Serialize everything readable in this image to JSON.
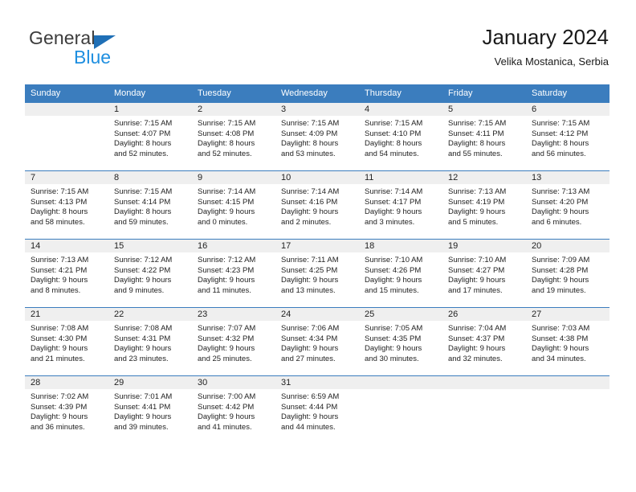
{
  "brand": {
    "name_top": "General",
    "name_bottom": "Blue",
    "triangle_color": "#1f6fb6",
    "blue_color": "#1f8fe0"
  },
  "header": {
    "title": "January 2024",
    "subtitle": "Velika Mostanica, Serbia"
  },
  "theme": {
    "header_blue": "#3b7dbe",
    "daynum_band": "#efefef",
    "text": "#222222"
  },
  "calendar": {
    "weekday_headers": [
      "Sunday",
      "Monday",
      "Tuesday",
      "Wednesday",
      "Thursday",
      "Friday",
      "Saturday"
    ],
    "weeks": [
      [
        {
          "day": "",
          "l1": "",
          "l2": "",
          "l3": "",
          "l4": ""
        },
        {
          "day": "1",
          "l1": "Sunrise: 7:15 AM",
          "l2": "Sunset: 4:07 PM",
          "l3": "Daylight: 8 hours",
          "l4": "and 52 minutes."
        },
        {
          "day": "2",
          "l1": "Sunrise: 7:15 AM",
          "l2": "Sunset: 4:08 PM",
          "l3": "Daylight: 8 hours",
          "l4": "and 52 minutes."
        },
        {
          "day": "3",
          "l1": "Sunrise: 7:15 AM",
          "l2": "Sunset: 4:09 PM",
          "l3": "Daylight: 8 hours",
          "l4": "and 53 minutes."
        },
        {
          "day": "4",
          "l1": "Sunrise: 7:15 AM",
          "l2": "Sunset: 4:10 PM",
          "l3": "Daylight: 8 hours",
          "l4": "and 54 minutes."
        },
        {
          "day": "5",
          "l1": "Sunrise: 7:15 AM",
          "l2": "Sunset: 4:11 PM",
          "l3": "Daylight: 8 hours",
          "l4": "and 55 minutes."
        },
        {
          "day": "6",
          "l1": "Sunrise: 7:15 AM",
          "l2": "Sunset: 4:12 PM",
          "l3": "Daylight: 8 hours",
          "l4": "and 56 minutes."
        }
      ],
      [
        {
          "day": "7",
          "l1": "Sunrise: 7:15 AM",
          "l2": "Sunset: 4:13 PM",
          "l3": "Daylight: 8 hours",
          "l4": "and 58 minutes."
        },
        {
          "day": "8",
          "l1": "Sunrise: 7:15 AM",
          "l2": "Sunset: 4:14 PM",
          "l3": "Daylight: 8 hours",
          "l4": "and 59 minutes."
        },
        {
          "day": "9",
          "l1": "Sunrise: 7:14 AM",
          "l2": "Sunset: 4:15 PM",
          "l3": "Daylight: 9 hours",
          "l4": "and 0 minutes."
        },
        {
          "day": "10",
          "l1": "Sunrise: 7:14 AM",
          "l2": "Sunset: 4:16 PM",
          "l3": "Daylight: 9 hours",
          "l4": "and 2 minutes."
        },
        {
          "day": "11",
          "l1": "Sunrise: 7:14 AM",
          "l2": "Sunset: 4:17 PM",
          "l3": "Daylight: 9 hours",
          "l4": "and 3 minutes."
        },
        {
          "day": "12",
          "l1": "Sunrise: 7:13 AM",
          "l2": "Sunset: 4:19 PM",
          "l3": "Daylight: 9 hours",
          "l4": "and 5 minutes."
        },
        {
          "day": "13",
          "l1": "Sunrise: 7:13 AM",
          "l2": "Sunset: 4:20 PM",
          "l3": "Daylight: 9 hours",
          "l4": "and 6 minutes."
        }
      ],
      [
        {
          "day": "14",
          "l1": "Sunrise: 7:13 AM",
          "l2": "Sunset: 4:21 PM",
          "l3": "Daylight: 9 hours",
          "l4": "and 8 minutes."
        },
        {
          "day": "15",
          "l1": "Sunrise: 7:12 AM",
          "l2": "Sunset: 4:22 PM",
          "l3": "Daylight: 9 hours",
          "l4": "and 9 minutes."
        },
        {
          "day": "16",
          "l1": "Sunrise: 7:12 AM",
          "l2": "Sunset: 4:23 PM",
          "l3": "Daylight: 9 hours",
          "l4": "and 11 minutes."
        },
        {
          "day": "17",
          "l1": "Sunrise: 7:11 AM",
          "l2": "Sunset: 4:25 PM",
          "l3": "Daylight: 9 hours",
          "l4": "and 13 minutes."
        },
        {
          "day": "18",
          "l1": "Sunrise: 7:10 AM",
          "l2": "Sunset: 4:26 PM",
          "l3": "Daylight: 9 hours",
          "l4": "and 15 minutes."
        },
        {
          "day": "19",
          "l1": "Sunrise: 7:10 AM",
          "l2": "Sunset: 4:27 PM",
          "l3": "Daylight: 9 hours",
          "l4": "and 17 minutes."
        },
        {
          "day": "20",
          "l1": "Sunrise: 7:09 AM",
          "l2": "Sunset: 4:28 PM",
          "l3": "Daylight: 9 hours",
          "l4": "and 19 minutes."
        }
      ],
      [
        {
          "day": "21",
          "l1": "Sunrise: 7:08 AM",
          "l2": "Sunset: 4:30 PM",
          "l3": "Daylight: 9 hours",
          "l4": "and 21 minutes."
        },
        {
          "day": "22",
          "l1": "Sunrise: 7:08 AM",
          "l2": "Sunset: 4:31 PM",
          "l3": "Daylight: 9 hours",
          "l4": "and 23 minutes."
        },
        {
          "day": "23",
          "l1": "Sunrise: 7:07 AM",
          "l2": "Sunset: 4:32 PM",
          "l3": "Daylight: 9 hours",
          "l4": "and 25 minutes."
        },
        {
          "day": "24",
          "l1": "Sunrise: 7:06 AM",
          "l2": "Sunset: 4:34 PM",
          "l3": "Daylight: 9 hours",
          "l4": "and 27 minutes."
        },
        {
          "day": "25",
          "l1": "Sunrise: 7:05 AM",
          "l2": "Sunset: 4:35 PM",
          "l3": "Daylight: 9 hours",
          "l4": "and 30 minutes."
        },
        {
          "day": "26",
          "l1": "Sunrise: 7:04 AM",
          "l2": "Sunset: 4:37 PM",
          "l3": "Daylight: 9 hours",
          "l4": "and 32 minutes."
        },
        {
          "day": "27",
          "l1": "Sunrise: 7:03 AM",
          "l2": "Sunset: 4:38 PM",
          "l3": "Daylight: 9 hours",
          "l4": "and 34 minutes."
        }
      ],
      [
        {
          "day": "28",
          "l1": "Sunrise: 7:02 AM",
          "l2": "Sunset: 4:39 PM",
          "l3": "Daylight: 9 hours",
          "l4": "and 36 minutes."
        },
        {
          "day": "29",
          "l1": "Sunrise: 7:01 AM",
          "l2": "Sunset: 4:41 PM",
          "l3": "Daylight: 9 hours",
          "l4": "and 39 minutes."
        },
        {
          "day": "30",
          "l1": "Sunrise: 7:00 AM",
          "l2": "Sunset: 4:42 PM",
          "l3": "Daylight: 9 hours",
          "l4": "and 41 minutes."
        },
        {
          "day": "31",
          "l1": "Sunrise: 6:59 AM",
          "l2": "Sunset: 4:44 PM",
          "l3": "Daylight: 9 hours",
          "l4": "and 44 minutes."
        },
        {
          "day": "",
          "l1": "",
          "l2": "",
          "l3": "",
          "l4": ""
        },
        {
          "day": "",
          "l1": "",
          "l2": "",
          "l3": "",
          "l4": ""
        },
        {
          "day": "",
          "l1": "",
          "l2": "",
          "l3": "",
          "l4": ""
        }
      ]
    ]
  }
}
